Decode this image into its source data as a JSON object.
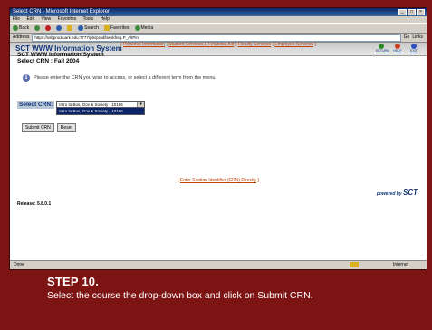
{
  "browser": {
    "title": "Select CRN - Microsoft Internet Explorer",
    "menu": [
      "File",
      "Edit",
      "View",
      "Favorites",
      "Tools",
      "Help"
    ],
    "toolbar": {
      "back": "Back",
      "search": "Search",
      "favorites": "Favorites",
      "media": "Media"
    },
    "address_label": "Address",
    "address": "https://ssbprod.uark.edu:7777/pls/prod/bwskfreg.P_AltPin",
    "go": "Go",
    "links": "Links"
  },
  "header": {
    "title": "SCT WWW Information System",
    "icons": [
      {
        "name": "return-icon",
        "label": "RETURN"
      },
      {
        "name": "help-icon",
        "label": "HELP"
      },
      {
        "name": "exit-icon",
        "label": "EXIT"
      }
    ]
  },
  "nav": {
    "items": [
      "Personal Information",
      "Student Services & Financial Aid",
      "Faculty Services",
      "Employee Services"
    ]
  },
  "page": {
    "system_name": "SCT WWW Information System",
    "heading": "Select CRN : Fall 2004",
    "info": "Please enter the CRN you wish to access, or select a different term from the menu.",
    "crn_label": "Select CRN:",
    "crn_selected": "Intro to Bus, Gov & Society - 10186",
    "crn_options": [
      "Intro to Bus, Gov & Society - 10186"
    ],
    "submit": "Submit CRN",
    "reset": "Reset",
    "enter_crn_link": "Enter Section Identifier (CRN) Directly",
    "powered_by": "powered by",
    "brand": "SCT",
    "release": "Release: 5.8.0.1"
  },
  "status": {
    "left": "Done",
    "zone": "Internet"
  },
  "caption": {
    "step": "STEP 10.",
    "instruction": "Select the course the drop-down box and click on Submit CRN."
  },
  "colors": {
    "slide_bg": "#7d1414",
    "link": "#c04000",
    "brand_blue": "#10357a"
  }
}
